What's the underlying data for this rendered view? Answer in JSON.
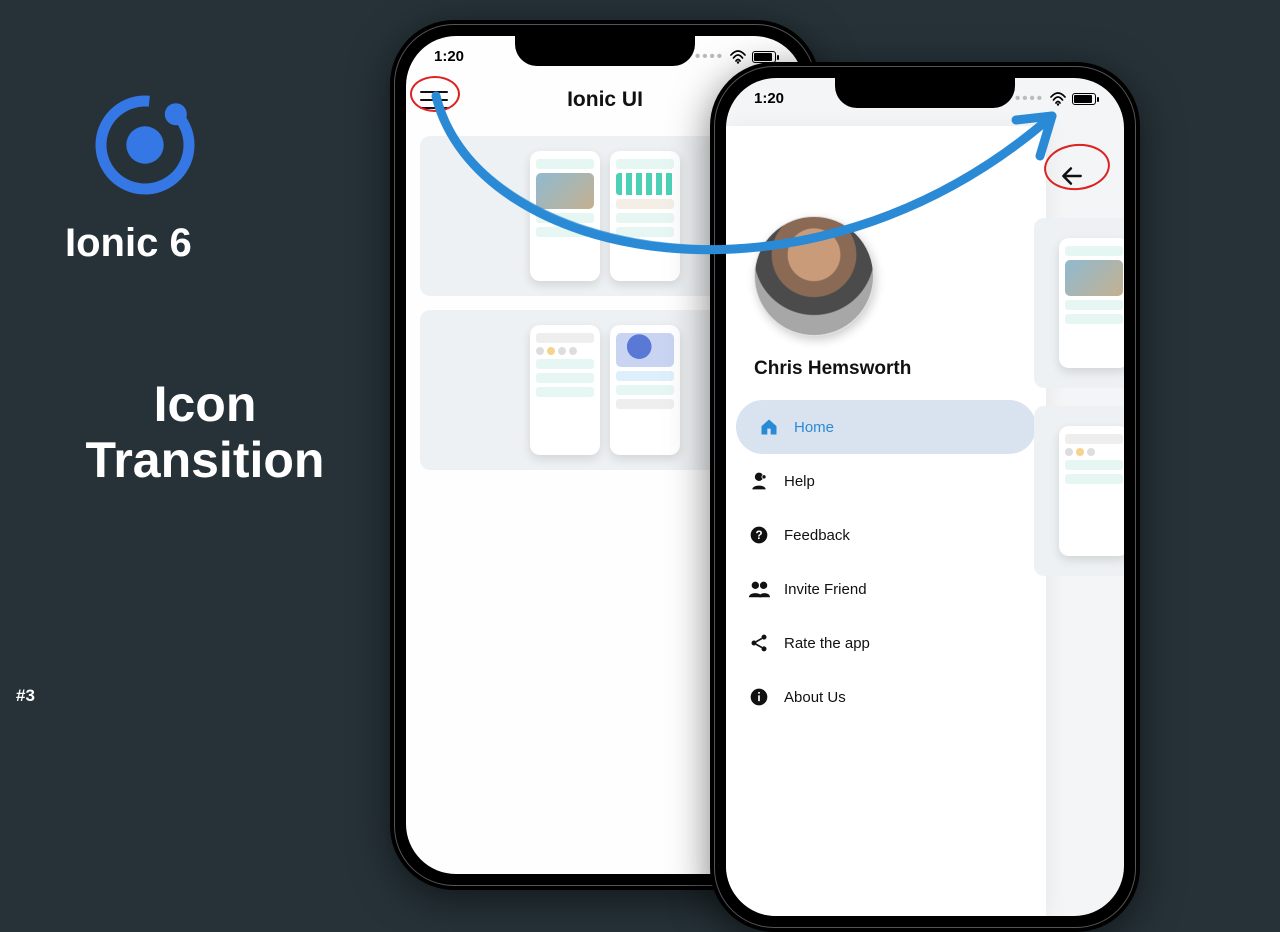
{
  "brand": "Ionic 6",
  "title_line1": "Icon",
  "title_line2": "Transition",
  "episode": "#3",
  "status_time": "1:20",
  "back_phone": {
    "app_title": "Ionic UI"
  },
  "front_phone": {
    "user_name": "Chris Hemsworth",
    "menu": [
      {
        "label": "Home",
        "active": true,
        "icon": "home"
      },
      {
        "label": "Help",
        "active": false,
        "icon": "help"
      },
      {
        "label": "Feedback",
        "active": false,
        "icon": "feedback"
      },
      {
        "label": "Invite Friend",
        "active": false,
        "icon": "invite"
      },
      {
        "label": "Rate the app",
        "active": false,
        "icon": "share"
      },
      {
        "label": "About Us",
        "active": false,
        "icon": "info"
      }
    ]
  }
}
